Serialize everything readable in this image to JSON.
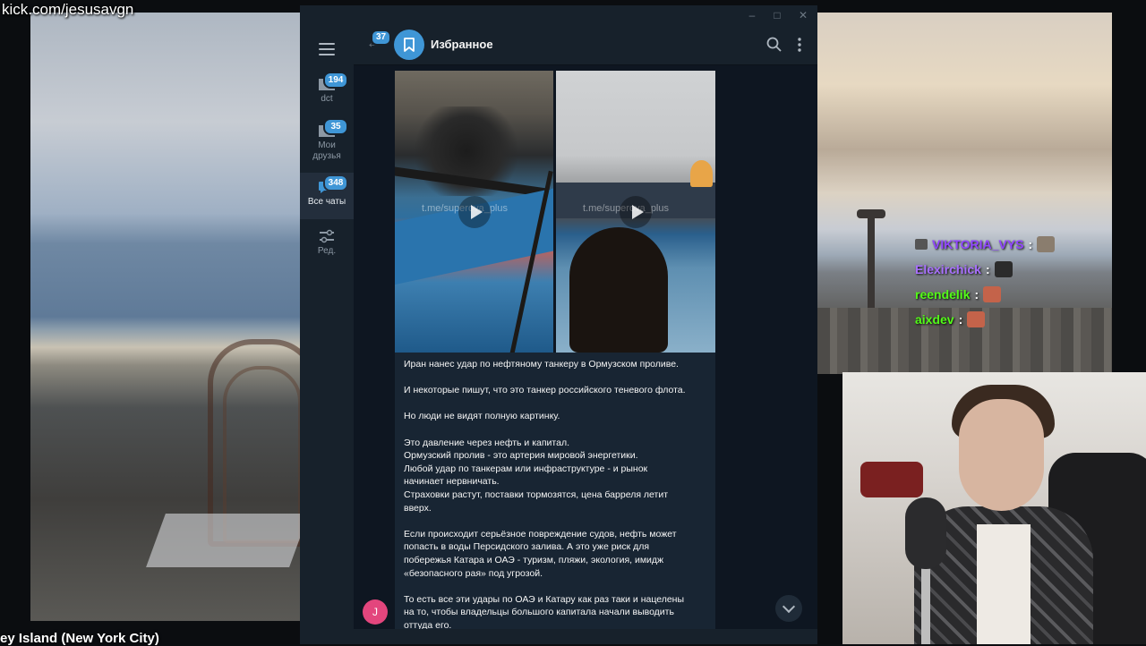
{
  "stream": {
    "url": "kick.com/jesusavgn",
    "location": "ey Island (New York City)",
    "chat": [
      {
        "user": "VIKTORIA_VYS",
        "color": "#9146ff"
      },
      {
        "user": "Elexirchick",
        "color": "#a970ff"
      },
      {
        "user": "reendelik",
        "color": "#53fc18"
      },
      {
        "user": "aixdev",
        "color": "#53fc18"
      }
    ]
  },
  "telegram": {
    "folders": [
      {
        "label": "dct",
        "count": "194",
        "icon": "folder-icon"
      },
      {
        "label": "Мои друзья",
        "count": "35",
        "icon": "folder-icon"
      },
      {
        "label": "Все чаты",
        "count": "348",
        "icon": "chats-icon",
        "active": true
      },
      {
        "label": "Ред.",
        "count": "",
        "icon": "edit-folders-icon"
      }
    ],
    "header": {
      "back_count": "37",
      "title": "Избранное"
    },
    "media": {
      "watermark_1": "t.me/superova_plus",
      "watermark_2": "t.me/superova_plus"
    },
    "message": {
      "paragraphs": [
        [
          "Иран нанес удар по нефтяному танкеру в Ормузском проливе."
        ],
        [
          "И некоторые пишут, что это танкер российского теневого флота."
        ],
        [
          "Но люди не видят полную картинку."
        ],
        [
          "Это давление через нефть и капитал.",
          "Ормузский пролив - это артерия мировой энергетики.",
          "Любой удар по танкерам или инфраструктуре - и рынок",
          "начинает нервничать.",
          "Страховки растут, поставки тормозятся, цена барреля летит",
          "вверх."
        ],
        [
          "Если происходит серьёзное повреждение судов, нефть может",
          "попасть в воды Персидского залива. А это уже риск для",
          "побережья Катара и ОАЭ - туризм, пляжи, экология, имидж",
          "«безопасного рая» под угрозой."
        ],
        [
          "То есть все эти удары по ОАЭ и Катару как раз таки и нацелены",
          "на то, чтобы владельцы большого капитала начали выводить",
          "оттуда его."
        ]
      ],
      "author_initial": "J"
    },
    "accent": "#3f96d6"
  }
}
